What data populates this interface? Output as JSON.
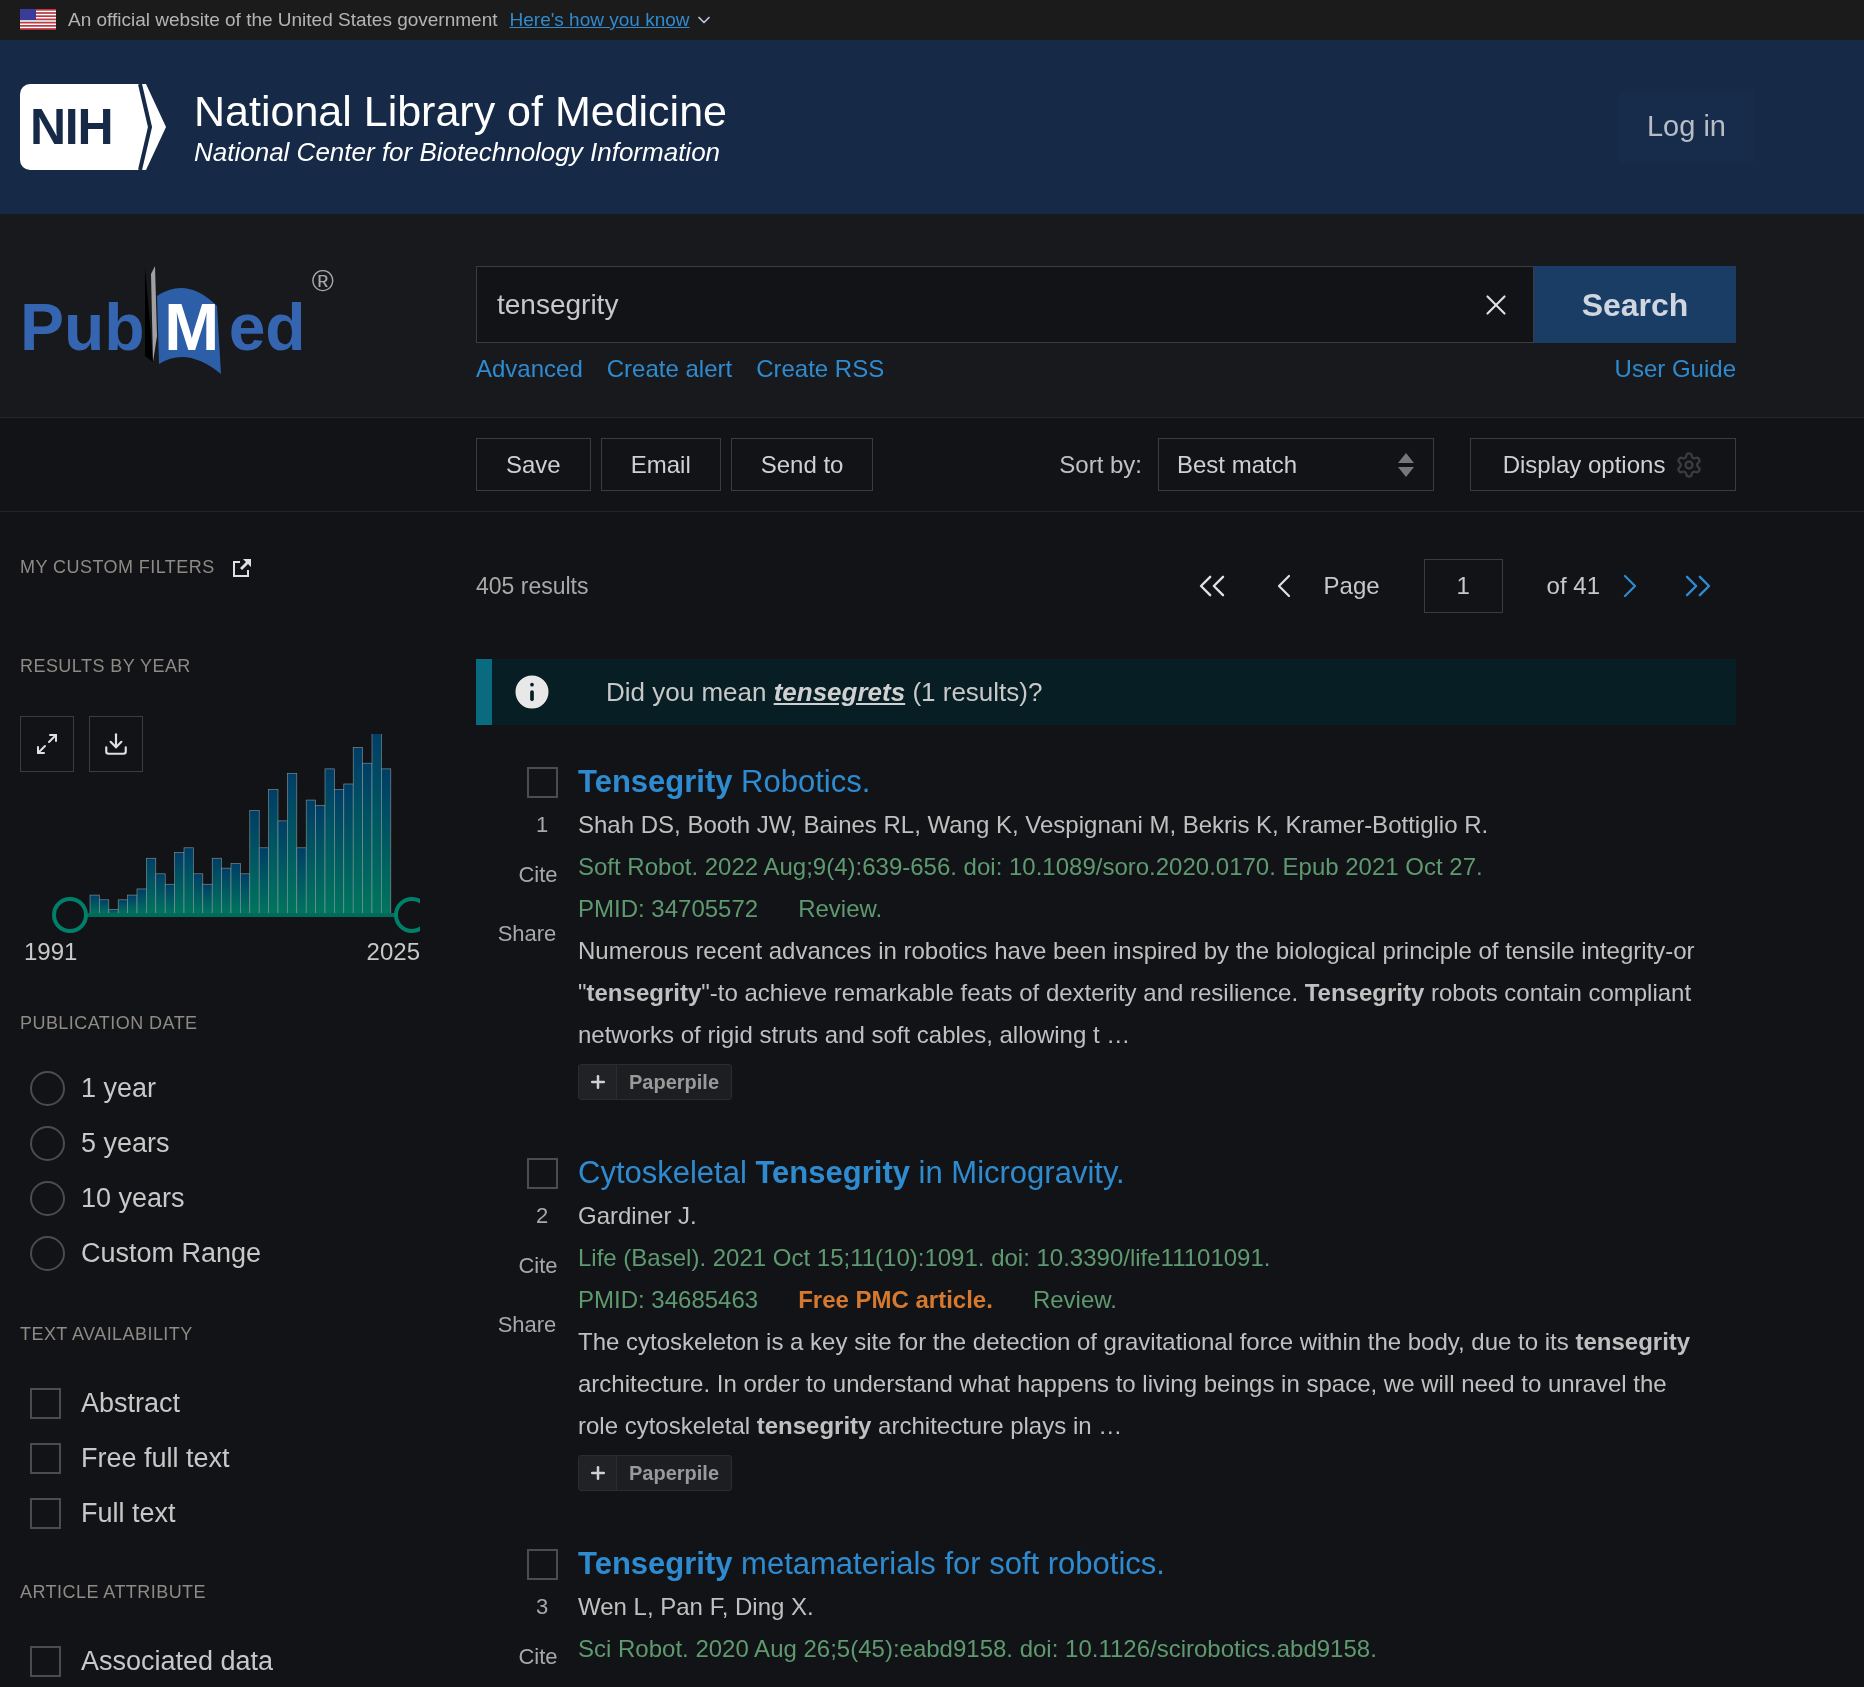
{
  "gov_banner": {
    "text": "An official website of the United States government",
    "link": "Here's how you know"
  },
  "header": {
    "logo": "NIH",
    "title": "National Library of Medicine",
    "subtitle": "National Center for Biotechnology Information",
    "login": "Log in"
  },
  "search": {
    "logo_parts": [
      "Pub",
      "M",
      "ed"
    ],
    "logo_mark": "®",
    "value": "tensegrity",
    "button": "Search",
    "links": [
      "Advanced",
      "Create alert",
      "Create RSS"
    ],
    "user_guide": "User Guide"
  },
  "toolbar": {
    "actions": [
      "Save",
      "Email",
      "Send to"
    ],
    "sort_label": "Sort by:",
    "sort_value": "Best match",
    "display_options": "Display options"
  },
  "sidebar": {
    "custom_filters": "MY CUSTOM FILTERS",
    "results_by_year": {
      "title": "RESULTS BY YEAR",
      "start_year": "1991",
      "end_year": "2025"
    },
    "publication_date": {
      "title": "PUBLICATION DATE",
      "options": [
        {
          "label": "1 year",
          "selected": false
        },
        {
          "label": "5 years",
          "selected": false
        },
        {
          "label": "10 years",
          "selected": false
        },
        {
          "label": "Custom Range",
          "selected": false
        }
      ]
    },
    "text_availability": {
      "title": "TEXT AVAILABILITY",
      "options": [
        {
          "label": "Abstract",
          "checked": false
        },
        {
          "label": "Free full text",
          "checked": false
        },
        {
          "label": "Full text",
          "checked": false
        }
      ]
    },
    "article_attribute": {
      "title": "ARTICLE ATTRIBUTE",
      "options": [
        {
          "label": "Associated data",
          "checked": false
        }
      ]
    }
  },
  "results": {
    "count": "405 results",
    "pagination": {
      "page_label": "Page",
      "page": "1",
      "of": "of 41"
    },
    "suggestion": {
      "prefix": "Did you mean",
      "term": "tensegrets",
      "suffix": "(1 results)?"
    },
    "articles": [
      {
        "number": "1",
        "checked": false,
        "actions": [
          "Cite",
          "Share"
        ],
        "title": "**Tensegrity** Robotics.",
        "authors": "Shah DS, Booth JW, Baines RL, Wang K, Vespignani M, Bekris K, Kramer-Bottiglio R.",
        "citation": "Soft Robot. 2022 Aug;9(4):639-656. doi: 10.1089/soro.2020.0170. Epub 2021 Oct 27.",
        "pmid": "PMID: 34705572",
        "tags": [
          {
            "kind": "type",
            "text": "Review."
          }
        ],
        "snippet": "Numerous recent advances in robotics have been inspired by the biological principle of tensile integrity-or \"**tensegrity**\"-to achieve remarkable feats of dexterity and resilience. **Tensegrity** robots contain compliant networks of rigid struts and soft cables, allowing t …",
        "paperpile": "Paperpile"
      },
      {
        "number": "2",
        "checked": false,
        "actions": [
          "Cite",
          "Share"
        ],
        "title": "Cytoskeletal **Tensegrity** in Microgravity.",
        "authors": "Gardiner J.",
        "citation": "Life (Basel). 2021 Oct 15;11(10):1091. doi: 10.3390/life11101091.",
        "pmid": "PMID: 34685463",
        "tags": [
          {
            "kind": "free",
            "text": "Free PMC article."
          },
          {
            "kind": "type",
            "text": "Review."
          }
        ],
        "snippet": "The cytoskeleton is a key site for the detection of gravitational force within the body, due to its **tensegrity** architecture. In order to understand what happens to living beings in space, we will need to unravel the role cytoskeletal **tensegrity** architecture plays in …",
        "paperpile": "Paperpile"
      },
      {
        "number": "3",
        "checked": false,
        "actions": [
          "Cite"
        ],
        "title": "**Tensegrity** metamaterials for soft robotics.",
        "authors": "Wen L, Pan F, Ding X.",
        "citation": "Sci Robot. 2020 Aug 26;5(45):eabd9158. doi: 10.1126/scirobotics.abd9158."
      }
    ]
  }
}
